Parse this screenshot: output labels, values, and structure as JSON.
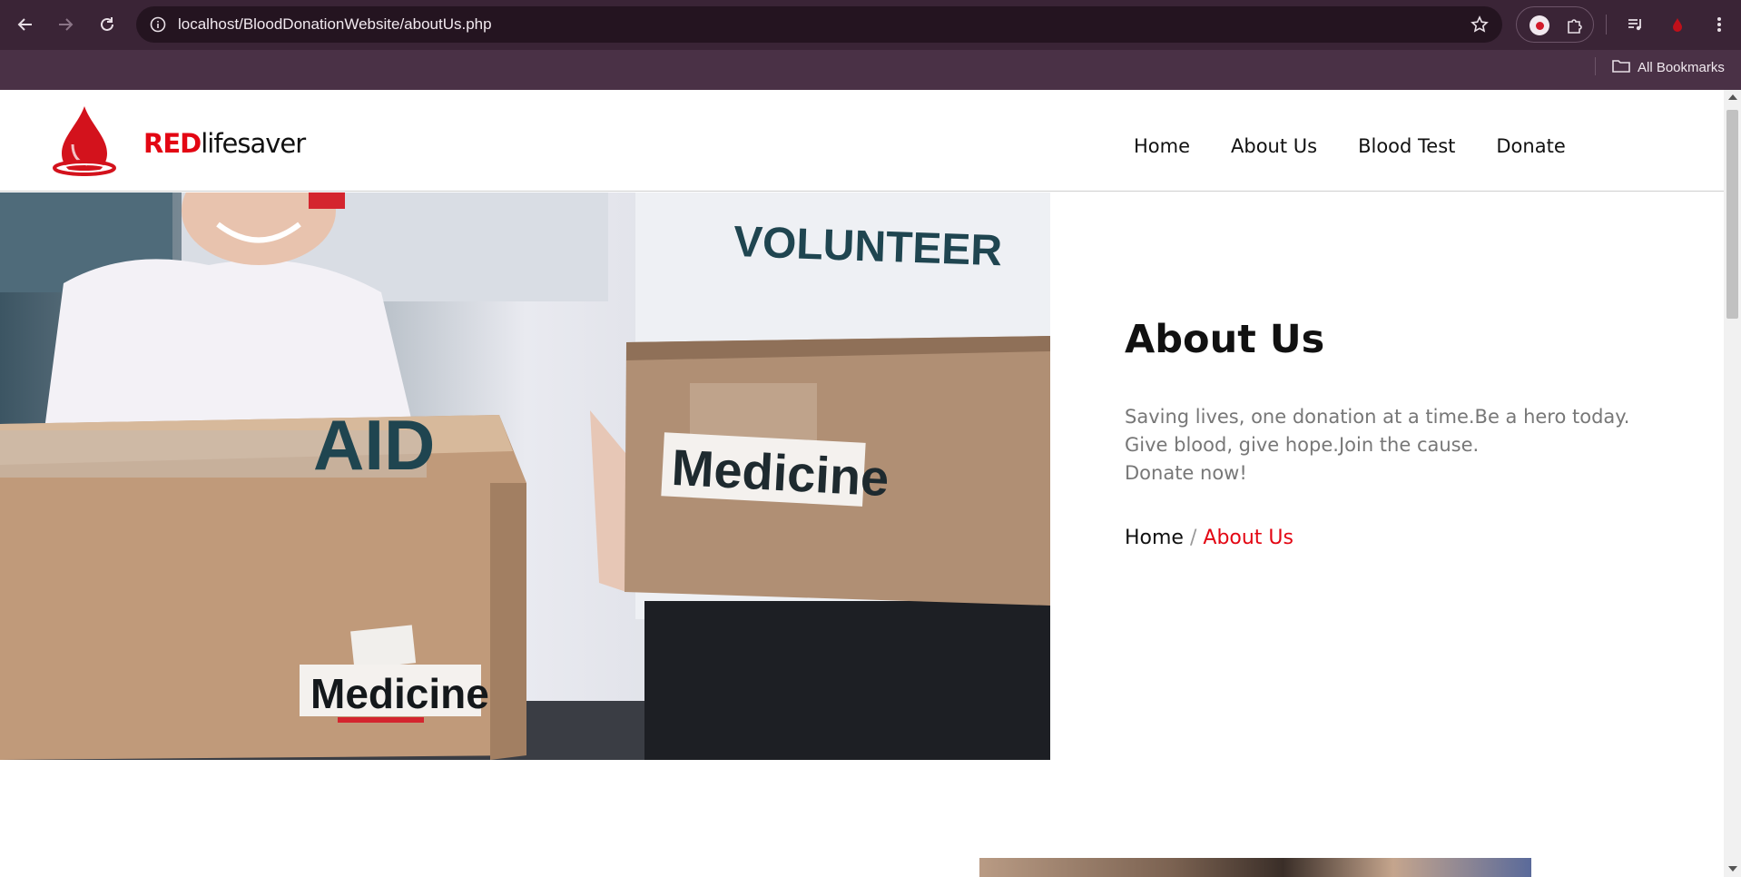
{
  "browser": {
    "url": "localhost/BloodDonationWebsite/aboutUs.php",
    "bookmarks_label": "All Bookmarks",
    "icons": {
      "back": "back-arrow-icon",
      "forward": "forward-arrow-icon",
      "reload": "reload-icon",
      "site_info": "info-icon",
      "bookmark_star": "star-icon",
      "record_extension": "record-icon",
      "extensions": "puzzle-icon",
      "media": "media-queue-icon",
      "extension_red": "red-drop-icon",
      "menu": "kebab-menu-icon",
      "bookmarks_folder": "folder-icon"
    }
  },
  "site": {
    "brand_primary": "RED",
    "brand_secondary": "lifesaver",
    "logo_icon": "blood-drop-logo-icon",
    "nav": [
      {
        "label": "Home"
      },
      {
        "label": "About Us"
      },
      {
        "label": "Blood Test"
      },
      {
        "label": "Donate"
      }
    ],
    "accent_color": "#e30613"
  },
  "hero": {
    "image_texts": {
      "volunteer_shirt": "VOLUNTEER",
      "aid_box": "AID",
      "box_label_right": "Medicine",
      "box_label_left": "Medicine"
    },
    "title": "About Us",
    "description_lines": [
      "Saving lives, one donation at a time.Be a hero today.",
      "Give blood, give hope.Join the cause.",
      "Donate now!"
    ],
    "breadcrumb": {
      "home": "Home",
      "separator": "/",
      "current": "About Us"
    }
  }
}
